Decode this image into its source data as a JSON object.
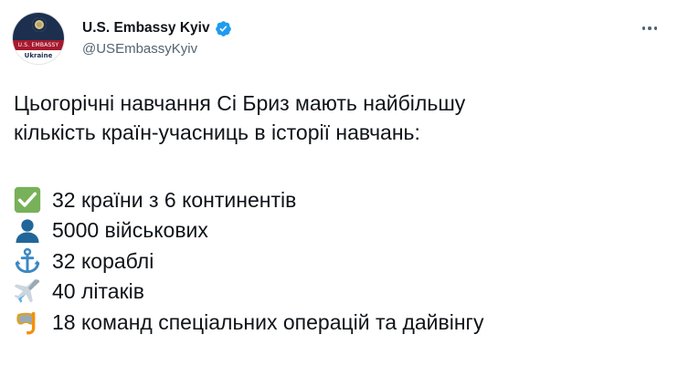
{
  "author": {
    "display_name": "U.S. Embassy Kyiv",
    "handle": "@USEmbassyKyiv",
    "verified": true,
    "avatar": {
      "stripe_text": "U.S. EMBASSY",
      "bottom_text": "Ukraine"
    }
  },
  "tweet": {
    "intro_lines": [
      "Цьогорічні навчання Сі Бриз мають найбільшу",
      "кількість країн-учасниць в історії навчань:"
    ],
    "items": [
      {
        "icon": "check-mark-button-icon",
        "text": "32 країни з 6 континентів"
      },
      {
        "icon": "bust-silhouette-icon",
        "text": "5000 військових"
      },
      {
        "icon": "anchor-icon",
        "text": "32 кораблі"
      },
      {
        "icon": "airplane-icon",
        "text": "40 літаків"
      },
      {
        "icon": "diving-mask-icon",
        "text": "18 команд спеціальних операцій та дайвінгу"
      }
    ]
  },
  "colors": {
    "text_primary": "#0f1419",
    "text_secondary": "#536471",
    "verified_blue": "#1d9bf0",
    "check_green": "#78b159",
    "bust_blue": "#269",
    "anchor_blue": "#3b88c3"
  }
}
